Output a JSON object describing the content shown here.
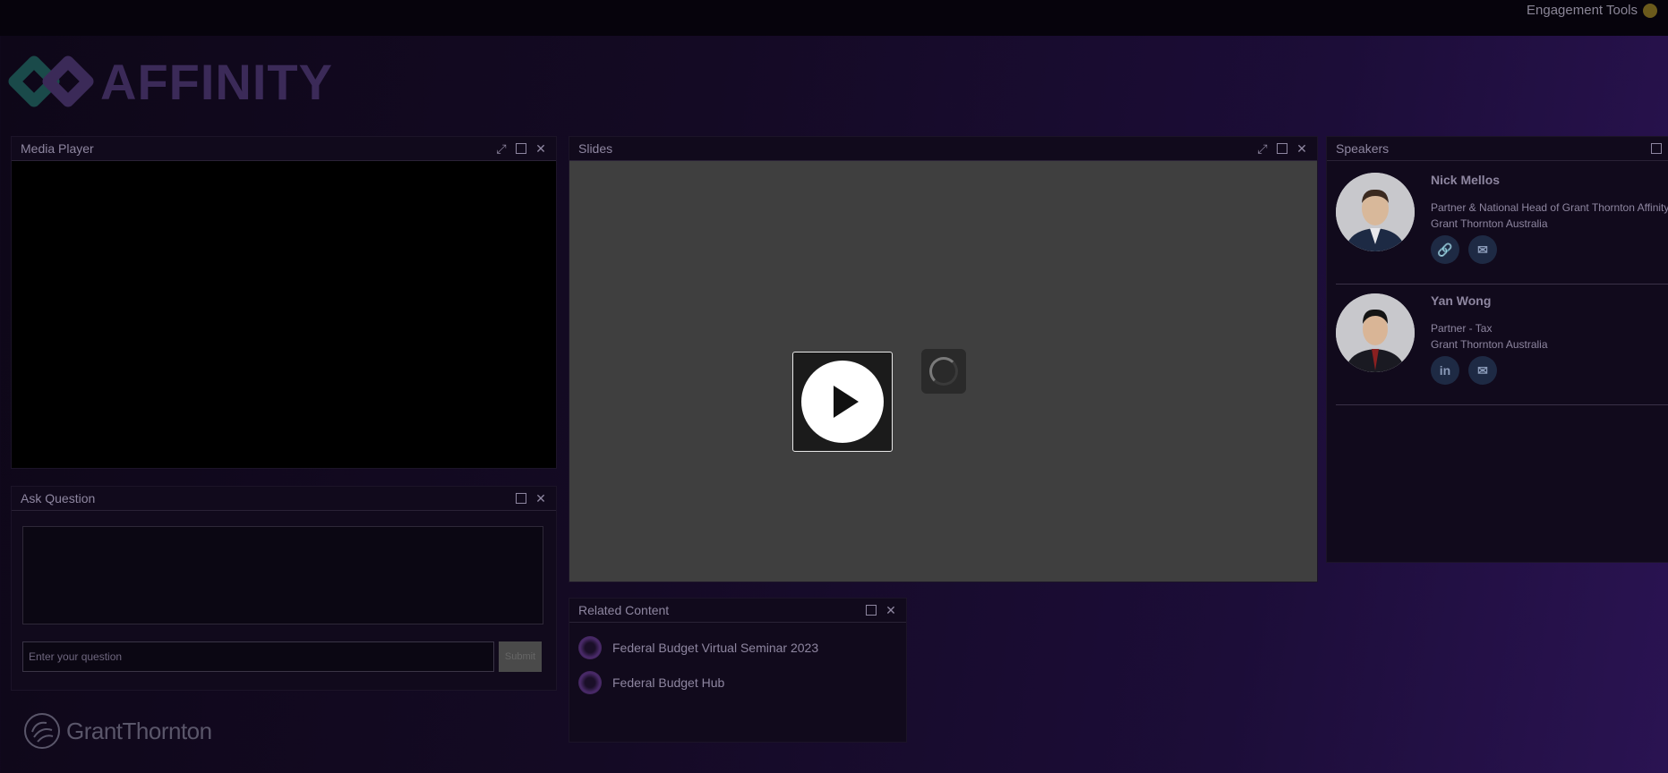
{
  "topbar": {
    "engagement_tools": "Engagement Tools"
  },
  "brand": {
    "logo_text": "AFFINITY"
  },
  "media_player": {
    "title": "Media Player"
  },
  "slides": {
    "title": "Slides"
  },
  "speakers": {
    "title": "Speakers",
    "items": [
      {
        "name": "Nick Mellos",
        "role": "Partner & National Head of Grant Thornton Affinity",
        "org": "Grant Thornton Australia",
        "icons": [
          "link-icon",
          "email-icon"
        ]
      },
      {
        "name": "Yan Wong",
        "role": "Partner - Tax",
        "org": "Grant Thornton Australia",
        "icons": [
          "linkedin-icon",
          "email-icon"
        ]
      }
    ]
  },
  "ask_question": {
    "title": "Ask Question",
    "placeholder": "Enter your question",
    "submit_label": "Submit"
  },
  "related_content": {
    "title": "Related Content",
    "items": [
      {
        "label": "Federal Budget Virtual Seminar 2023"
      },
      {
        "label": "Federal Budget Hub"
      }
    ]
  },
  "footer": {
    "logo_text": "GrantThornton"
  },
  "colors": {
    "accent": "#2a1352",
    "logo": "#3b2a58"
  }
}
